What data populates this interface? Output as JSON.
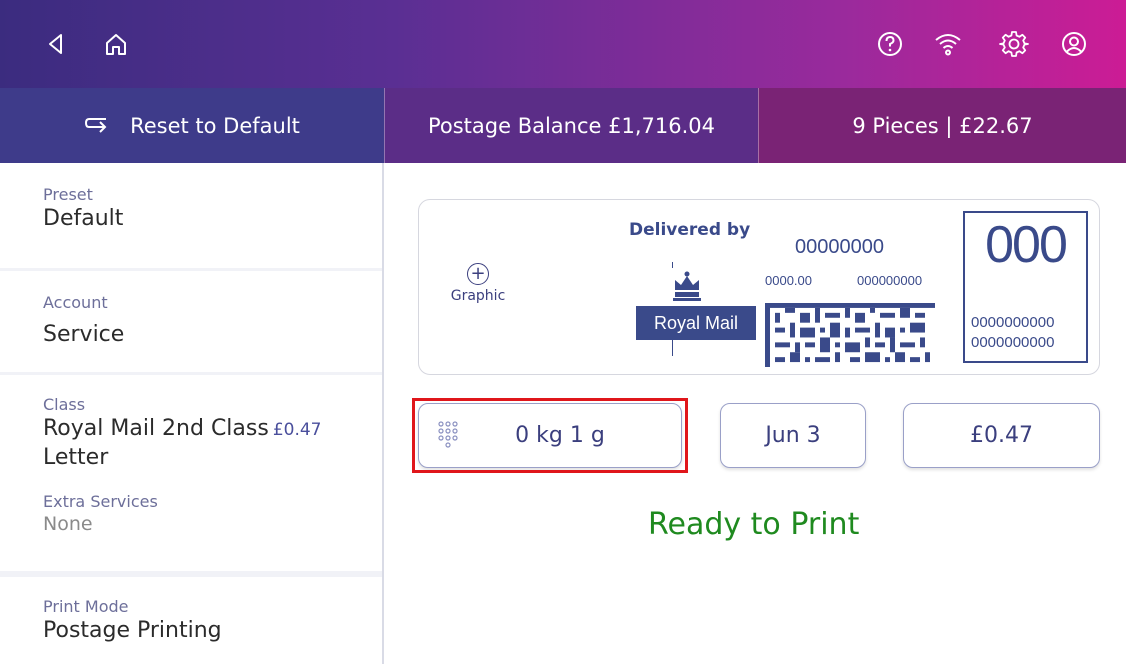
{
  "topbar": {
    "icons_left": [
      "back-icon",
      "home-icon"
    ],
    "icons_right": [
      "help-icon",
      "wifi-icon",
      "settings-icon",
      "account-icon"
    ]
  },
  "subbar": {
    "reset_label": "Reset to Default",
    "balance_label": "Postage Balance £1,716.04",
    "pieces_label": "9 Pieces | £22.67"
  },
  "sidebar": {
    "preset": {
      "label": "Preset",
      "value": "Default"
    },
    "account": {
      "label": "Account",
      "value": "Service"
    },
    "class": {
      "label": "Class",
      "value": "Royal Mail 2nd Class",
      "price": "£0.47",
      "format": "Letter"
    },
    "extra_services": {
      "label": "Extra Services",
      "value": "None"
    },
    "print_mode": {
      "label": "Print Mode",
      "value": "Postage Printing"
    }
  },
  "indicia": {
    "graphic_label": "Graphic",
    "delivered_by": "Delivered by",
    "logo_text": "Royal Mail",
    "code_main": "00000000",
    "code_left": "0000.00",
    "code_right": "000000000",
    "big_number": "000",
    "line1": "0000000000",
    "line2": "0000000000"
  },
  "controls": {
    "weight": "0 kg 1 g",
    "date": "Jun 3",
    "amount": "£0.47"
  },
  "status": "Ready to Print",
  "colors": {
    "accent": "#3b3f7e",
    "ready": "#1f8a1f",
    "highlight": "#e0161b"
  }
}
